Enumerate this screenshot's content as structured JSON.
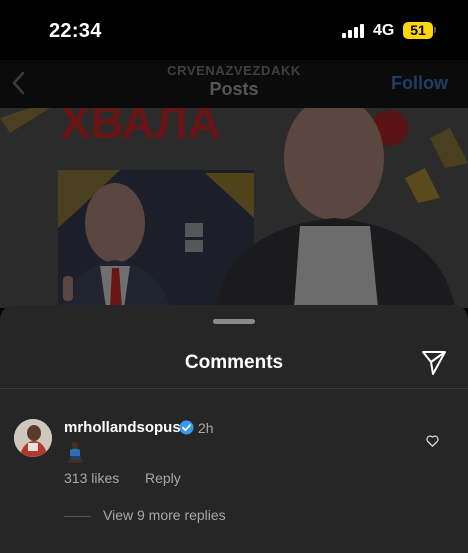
{
  "status_bar": {
    "time": "22:34",
    "network": "4G",
    "battery": "51"
  },
  "header": {
    "account": "CRVENAZVEZDAKK",
    "title": "Posts",
    "follow_label": "Follow"
  },
  "post_image": {
    "headline_text": "ХВАЛА"
  },
  "comments_sheet": {
    "title": "Comments",
    "comment": {
      "username": "mrhollandsopus",
      "verified": true,
      "time": "2h",
      "text": "🧎🏿‍♂️",
      "likes": "313 likes",
      "reply_label": "Reply",
      "view_replies": "View 9 more replies"
    }
  },
  "icons": [
    "back-chevron-icon",
    "share-send-icon",
    "verified-badge-icon",
    "heart-icon"
  ],
  "colors": {
    "follow": "#1d3f66",
    "verified": "#3897f0",
    "battery": "#ffd60a"
  }
}
